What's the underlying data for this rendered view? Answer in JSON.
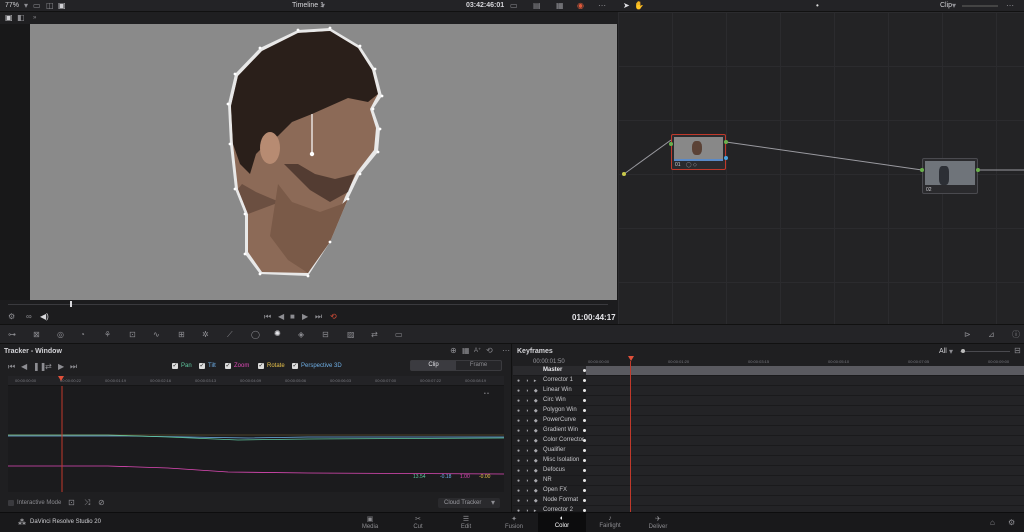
{
  "topbar": {
    "zoom": "77%",
    "timeline_name": "Timeline 1",
    "timecode": "03:42:46:01",
    "clip_mode": "Clip"
  },
  "viewer": {
    "timecode": "01:00:44:17"
  },
  "nodes": [
    {
      "label": "01"
    },
    {
      "label": "02"
    }
  ],
  "tracker": {
    "title": "Tracker - Window",
    "checks": [
      {
        "label": "Pan",
        "color": "#5fc9a0"
      },
      {
        "label": "Tilt",
        "color": "#6fb0e8"
      },
      {
        "label": "Zoom",
        "color": "#e04ab8"
      },
      {
        "label": "Rotate",
        "color": "#e8c24a"
      },
      {
        "label": "Perspective 3D",
        "color": "#6fb0e8"
      }
    ],
    "mode_tabs": [
      "Clip",
      "Frame"
    ],
    "mode_selected": "Clip",
    "ruler": [
      "00:00:00:00",
      "00:00:00:22",
      "00:00:01:19",
      "00:00:02:16",
      "00:00:03:13",
      "00:00:04:09",
      "00:00:05:06",
      "00:00:06:03",
      "00:00:07:00",
      "00:00:07:22",
      "00:00:08:19"
    ],
    "values": [
      {
        "text": "13.54",
        "color": "#5fc9a0"
      },
      {
        "text": "-0.18",
        "color": "#6fb0e8"
      },
      {
        "text": "1.00",
        "color": "#e04ab8"
      },
      {
        "text": "-0.00",
        "color": "#e8c24a"
      }
    ],
    "interactive_mode": "Interactive Mode",
    "cloud_tracker": "Cloud Tracker"
  },
  "keyframes": {
    "title": "Keyframes",
    "filter": "All",
    "timecode": "00:00:01:50",
    "ruler": [
      "00:00:00:00",
      "00:00:01:20",
      "00:00:03:15",
      "00:00:05:10",
      "00:00:07:05",
      "00:00:09:00"
    ],
    "master": "Master",
    "rows": [
      "Corrector 1",
      "Linear Win",
      "Circ Win",
      "Polygon Win",
      "PowerCurve",
      "Gradient Win",
      "Color Corrector",
      "Qualifier",
      "Misc Isolation",
      "Defocus",
      "NR",
      "Open FX",
      "Node Format",
      "Corrector 2"
    ]
  },
  "app": {
    "name": "DaVinci Resolve Studio 20"
  },
  "pages": [
    {
      "label": "Media",
      "icon": "▣"
    },
    {
      "label": "Cut",
      "icon": "✂"
    },
    {
      "label": "Edit",
      "icon": "☰"
    },
    {
      "label": "Fusion",
      "icon": "✦"
    },
    {
      "label": "Color",
      "icon": "◐"
    },
    {
      "label": "Fairlight",
      "icon": "♪"
    },
    {
      "label": "Deliver",
      "icon": "✈"
    }
  ],
  "selected_page": "Color"
}
